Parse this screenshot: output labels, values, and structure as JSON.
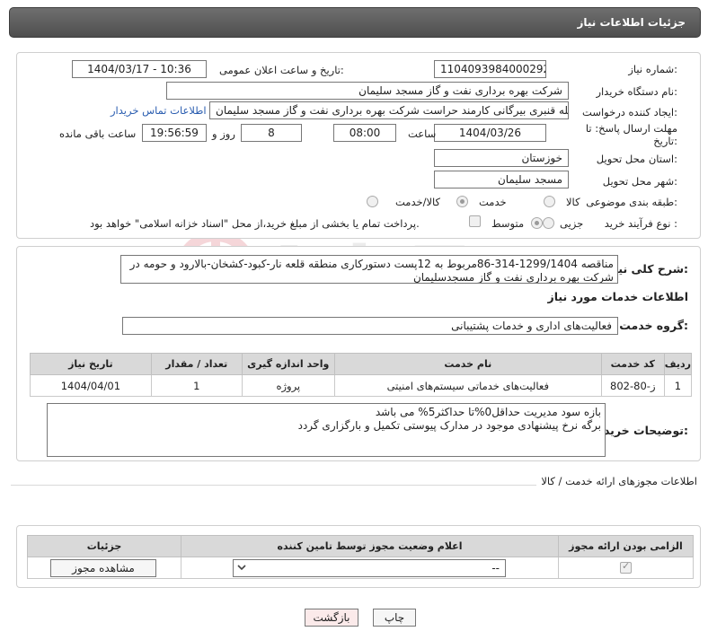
{
  "header": {
    "title": "جزئیات اطلاعات نیاز"
  },
  "form": {
    "need_number_label": "شماره نیاز:",
    "need_number": "1104093984000292",
    "announce_label": "تاریخ و ساعت اعلان عمومی:",
    "announce_value": "1404/03/17 - 10:36",
    "buyer_label": "نام دستگاه خریدار:",
    "buyer_value": "شرکت بهره برداری نفت و گاز مسجد سلیمان",
    "creator_label": "ایجاد کننده درخواست:",
    "creator_value": "فرج الله قنبری بیرگانی کارمند حراست شرکت بهره برداری نفت و گاز مسجد سلیمان",
    "contact_link": "اطلاعات تماس خریدار",
    "deadline_label": "مهلت ارسال پاسخ: تا تاریخ:",
    "deadline_date": "1404/03/26",
    "time_label": "ساعت",
    "deadline_time": "08:00",
    "days_value": "8",
    "days_label": "روز و",
    "remaining_time": "19:56:59",
    "remaining_label": "ساعت باقی مانده",
    "province_label": "استان محل تحویل:",
    "province_value": "خوزستان",
    "city_label": "شهر محل تحویل:",
    "city_value": "مسجد سلیمان",
    "category_label": "طبقه بندی موضوعی:",
    "category_options": [
      "کالا",
      "خدمت",
      "کالا/خدمت"
    ],
    "process_label": "نوع فرآیند خرید :",
    "process_options": [
      "جزیی",
      "متوسط"
    ],
    "payment_note": "پرداخت تمام یا بخشی از مبلغ خرید،از محل \"اسناد خزانه اسلامی\" خواهد بود."
  },
  "summary": {
    "label": "شرح کلی نیاز:",
    "text": "مناقصه 1299/1404-314-86مربوط به 12پست دستورکاری منطقه قلعه نار-کبود-کشخان-بالارود و حومه در شرکت بهره برداری نفت و گاز مسجدسلیمان"
  },
  "services": {
    "section_title": "اطلاعات خدمات مورد نیاز",
    "group_label": "گروه خدمت:",
    "group_value": "فعالیت‌های اداری و خدمات پشتیبانی",
    "columns": [
      "ردیف",
      "کد خدمت",
      "نام خدمت",
      "واحد اندازه گیری",
      "تعداد / مقدار",
      "تاریخ نیاز"
    ],
    "rows": [
      [
        "1",
        "ز-80-802",
        "فعالیت‌های خدماتی سیستم‌های امنیتی",
        "پروژه",
        "1",
        "1404/04/01"
      ]
    ]
  },
  "buyer_notes": {
    "label": "توضیحات خریدار:",
    "line1": "بازه سود مدیریت حداقل0%تا حداکثر5% می باشد",
    "line2": "برگه نرخ پیشنهادی موجود در مدارک پیوستی تکمیل و بارگزاری گردد"
  },
  "permits": {
    "section_title": "اطلاعات مجوزهای ارائه خدمت / کالا",
    "columns": [
      "الزامی بودن ارائه مجوز",
      "اعلام وضعیت مجوز توسط تامین کننده",
      "جزئیات"
    ],
    "select_value": "--",
    "view_button": "مشاهده مجوز"
  },
  "buttons": {
    "print": "چاپ",
    "back": "بازگشت"
  }
}
